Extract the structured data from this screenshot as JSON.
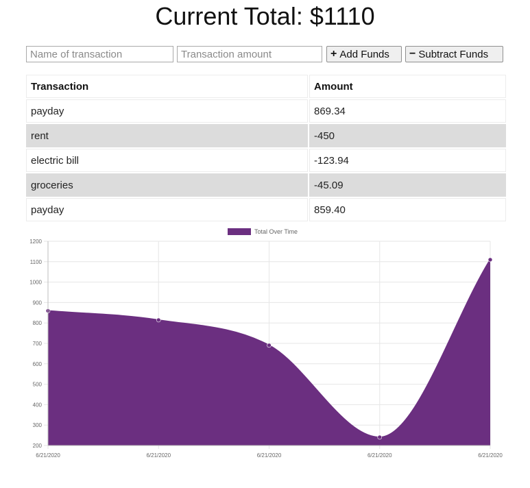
{
  "header": {
    "title": "Current Total: $1110"
  },
  "form": {
    "name_placeholder": "Name of transaction",
    "amount_placeholder": "Transaction amount",
    "add_label": "Add Funds",
    "subtract_label": "Subtract Funds",
    "add_icon": "plus-icon",
    "subtract_icon": "minus-icon"
  },
  "table": {
    "headers": [
      "Transaction",
      "Amount"
    ],
    "rows": [
      {
        "name": "payday",
        "amount": "869.34"
      },
      {
        "name": "rent",
        "amount": "-450"
      },
      {
        "name": "electric bill",
        "amount": "-123.94"
      },
      {
        "name": "groceries",
        "amount": "-45.09"
      },
      {
        "name": "payday",
        "amount": "859.40"
      }
    ]
  },
  "colors": {
    "series": "#6b2f80",
    "stripe": "#dcdcdc",
    "grid": "#e6e6e6"
  },
  "chart_data": {
    "type": "area",
    "legend": "Total Over Time",
    "legend_position": "top-center",
    "x": [
      "6/21/2020",
      "6/21/2020",
      "6/21/2020",
      "6/21/2020",
      "6/21/2020"
    ],
    "series": [
      {
        "name": "Total Over Time",
        "values": [
          859.4,
          814.31,
          690.37,
          240.37,
          1109.71
        ]
      }
    ],
    "ylim": [
      200,
      1200
    ],
    "yticks": [
      "200",
      "300",
      "400",
      "500",
      "600",
      "700",
      "800",
      "900",
      "1000",
      "1100",
      "1200"
    ],
    "grid": true
  }
}
